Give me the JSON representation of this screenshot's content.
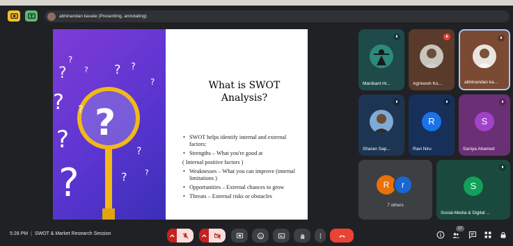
{
  "topbar": {
    "presenter_text": "abhinandan kavale (Presenting, annotating)"
  },
  "slide": {
    "title_line1": "What is SWOT",
    "title_line2": "Analysis?",
    "bullets": [
      "SWOT helps identify internal and external factors:",
      "Strengths – What you're good at",
      "( Internal positive factors )",
      "Weaknesses – What you can improve (internal limitations )",
      "Opportunities – External chances to grow",
      "Threats – External risks or obstacles"
    ]
  },
  "participants": {
    "tile1_name": "Manikant Hi...",
    "tile2_name": "Agnivesh Ko...",
    "tile3_name": "abhinandan ka...",
    "tile4_name": "Sharan Sap...",
    "tile5_name": "Ravi Niru",
    "tile5_initial": "R",
    "tile6_name": "Saniya Ahamed",
    "tile6_initial": "S",
    "others_label": "7 others",
    "others_initial1": "R",
    "others_initial2": "r",
    "tile8_name": "Social-Media & Digital ...",
    "tile8_initial": "S"
  },
  "bottombar": {
    "time": "5:28 PM",
    "meeting_name": "SWOT & Market Research Session",
    "people_count": "17"
  },
  "colors": {
    "background": "#202124",
    "end_call": "#ea4335",
    "accent_border": "#a8c7fa"
  }
}
